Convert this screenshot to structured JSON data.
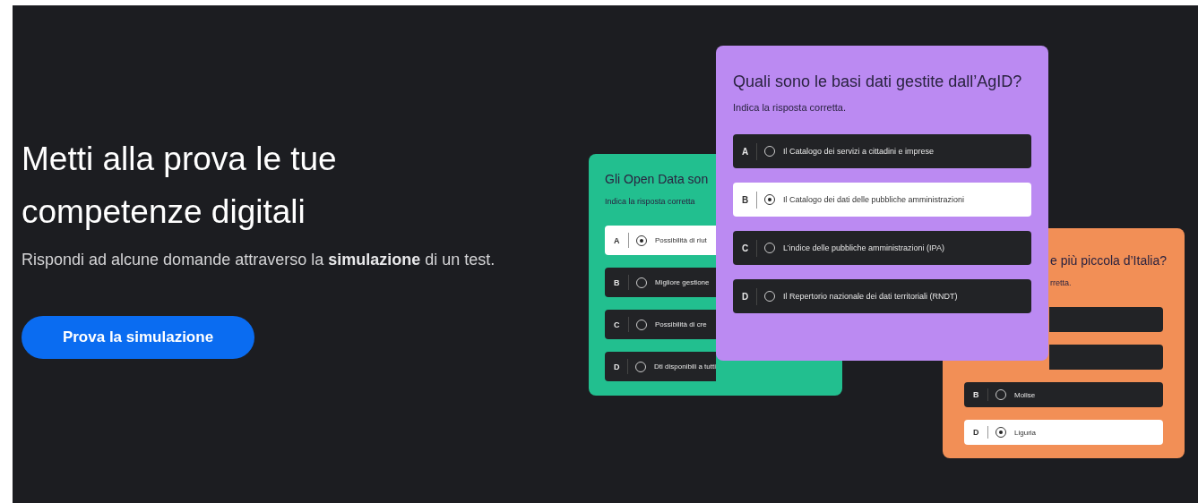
{
  "hero": {
    "title": "Metti alla prova le tue competenze digitali",
    "subtitle": "Rispondi ad alcune domande attraverso la **simulazione** di un test.",
    "button": "Prova la simulazione"
  },
  "cards": [
    {
      "color": "#22bf8f",
      "title": "Gli Open Data son",
      "subtitle": "Indica la risposta  corretta",
      "options": [
        {
          "letter": "A",
          "text": "Possibilità di riut",
          "selected": true
        },
        {
          "letter": "B",
          "text": "Migliore gestione",
          "selected": false
        },
        {
          "letter": "C",
          "text": "Possibilità di cre",
          "selected": false
        },
        {
          "letter": "D",
          "text": "Dti disponibili a tutti",
          "selected": false
        }
      ]
    },
    {
      "color": "#bb8af2",
      "title": "Quali sono le basi dati gestite dall’AgID?",
      "subtitle": "Indica la risposta  corretta.",
      "options": [
        {
          "letter": "A",
          "text": "Il Catalogo dei servizi a cittadini e imprese",
          "selected": false
        },
        {
          "letter": "B",
          "text": "Il Catalogo dei dati delle pubbliche amministrazioni",
          "selected": true
        },
        {
          "letter": "C",
          "text": "L’indice delle pubbliche amministrazioni (IPA)",
          "selected": false
        },
        {
          "letter": "D",
          "text": "Il Repertorio nazionale dei dati territoriali (RNDT)",
          "selected": false
        }
      ]
    },
    {
      "color": "#f28f56",
      "title": "e più piccola d’Italia?",
      "subtitle": "rretta.",
      "options": [
        {
          "selected": false
        },
        {
          "selected": false
        },
        {
          "letter": "B",
          "text": "Molise",
          "selected": false
        },
        {
          "letter": "D",
          "text": "Liguria",
          "selected": true
        }
      ]
    }
  ]
}
